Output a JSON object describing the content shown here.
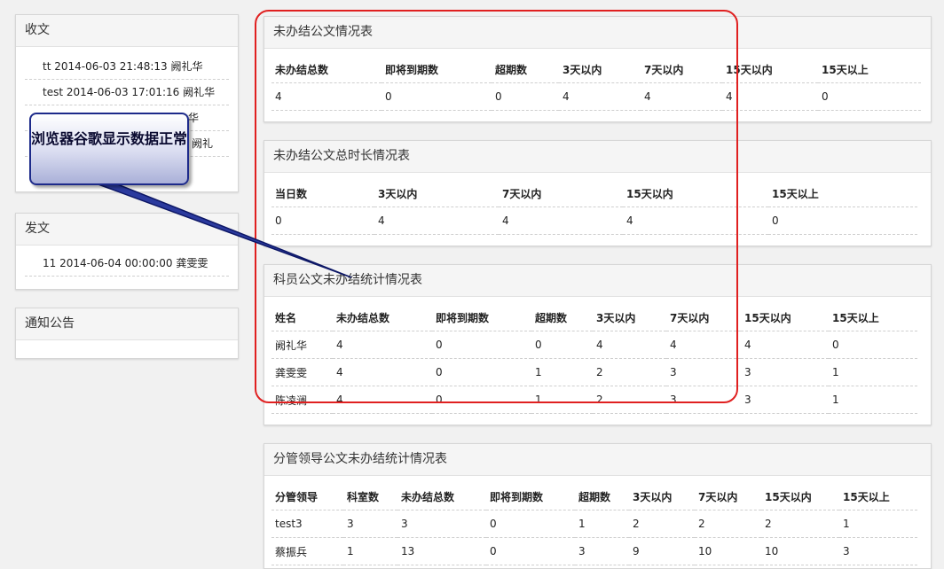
{
  "sidebar": {
    "inbox": {
      "title": "收文",
      "items": [
        "tt 2014-06-03 21:48:13 阙礼华",
        "test 2014-06-03 17:01:16 阙礼华",
        "华",
        "5 阙礼"
      ]
    },
    "outbox": {
      "title": "发文",
      "items": [
        "11 2014-06-04 00:00:00 龚雯雯"
      ]
    },
    "notice": {
      "title": "通知公告"
    }
  },
  "panels": {
    "undone": {
      "title": "未办结公文情况表",
      "headers": [
        "未办结总数",
        "即将到期数",
        "超期数",
        "3天以内",
        "7天以内",
        "15天以内",
        "15天以上"
      ],
      "rows": [
        [
          "4",
          "0",
          "0",
          "4",
          "4",
          "4",
          "0"
        ]
      ]
    },
    "duration": {
      "title": "未办结公文总时长情况表",
      "headers": [
        "当日数",
        "3天以内",
        "7天以内",
        "15天以内",
        "15天以上"
      ],
      "rows": [
        [
          "0",
          "4",
          "4",
          "4",
          "0"
        ]
      ]
    },
    "staff": {
      "title": "科员公文未办结统计情况表",
      "headers": [
        "姓名",
        "未办结总数",
        "即将到期数",
        "超期数",
        "3天以内",
        "7天以内",
        "15天以内",
        "15天以上"
      ],
      "rows": [
        [
          "阙礼华",
          "4",
          "0",
          "0",
          "4",
          "4",
          "4",
          "0"
        ],
        [
          "龚雯雯",
          "4",
          "0",
          "1",
          "2",
          "3",
          "3",
          "1"
        ],
        [
          "陈凌澜",
          "4",
          "0",
          "1",
          "2",
          "3",
          "3",
          "1"
        ]
      ]
    },
    "leader": {
      "title": "分管领导公文未办结统计情况表",
      "headers": [
        "分管领导",
        "科室数",
        "未办结总数",
        "即将到期数",
        "超期数",
        "3天以内",
        "7天以内",
        "15天以内",
        "15天以上"
      ],
      "rows": [
        [
          "test3",
          "3",
          "3",
          "0",
          "1",
          "2",
          "2",
          "2",
          "1"
        ],
        [
          "蔡振兵",
          "1",
          "13",
          "0",
          "3",
          "9",
          "10",
          "10",
          "3"
        ]
      ]
    }
  },
  "annotation": {
    "callout_text": "浏览器谷歌显示数据正常",
    "callout_color": "#1d2a8a",
    "highlight_color": "#e02020"
  }
}
